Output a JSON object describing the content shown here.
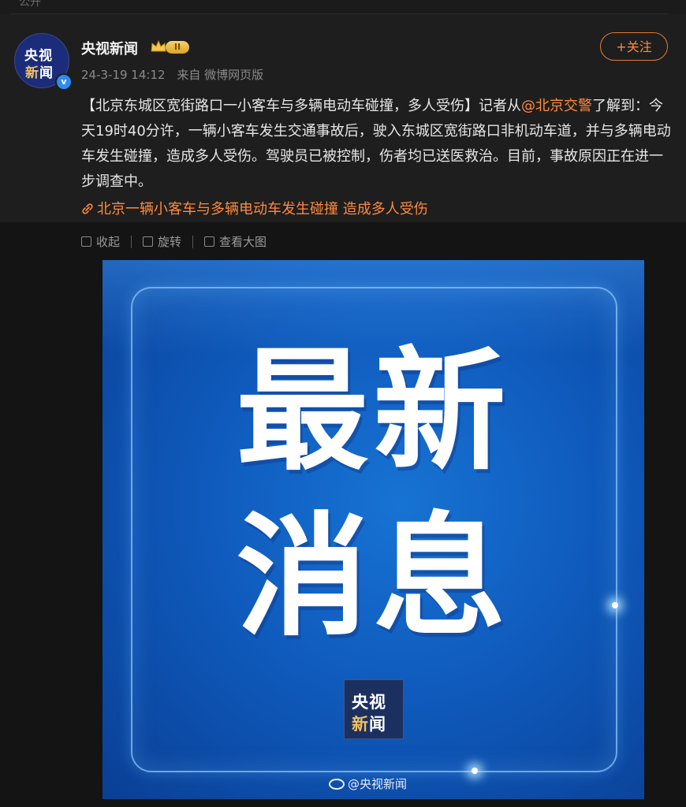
{
  "top_strip": {
    "label": "公开"
  },
  "author": {
    "name": "央视新闻",
    "avatar_line1": "央视",
    "avatar_line2a": "新",
    "avatar_line2b": "闻",
    "level_badge": "II",
    "verified_mark": "v",
    "timestamp": "24-3-19 14:12",
    "source": "来自 微博网页版"
  },
  "follow_button": {
    "label": "+关注"
  },
  "post": {
    "text_before_mention": "【北京东城区宽街路口一小客车与多辆电动车碰撞，多人受伤】记者从",
    "mention": "@北京交警",
    "text_after_mention": "了解到：今天19时40分许，一辆小客车发生交通事故后，驶入东城区宽街路口非机动车道，并与多辆电动车发生碰撞，造成多人受伤。驾驶员已被控制，伤者均已送医救治。目前，事故原因正在进一步调查中。",
    "link_text": "北京一辆小客车与多辆电动车发生碰撞 造成多人受伤"
  },
  "toolbar": {
    "collapse": "收起",
    "rotate": "旋转",
    "view_large": "查看大图"
  },
  "image": {
    "headline_line1": "最新",
    "headline_line2": "消息",
    "logo_line1": "央视",
    "logo_line2a": "新",
    "logo_line2b": "闻",
    "watermark": "@央视新闻"
  },
  "colors": {
    "accent": "#ff8a3d",
    "background": "#141414",
    "card": "#1e1e1e",
    "verified": "#2f8cf2",
    "image_blue": "#0f5bbd"
  },
  "icons": [
    "crown-icon",
    "verified-icon",
    "link-icon",
    "collapse-icon",
    "rotate-icon",
    "view-large-icon",
    "weibo-icon"
  ]
}
